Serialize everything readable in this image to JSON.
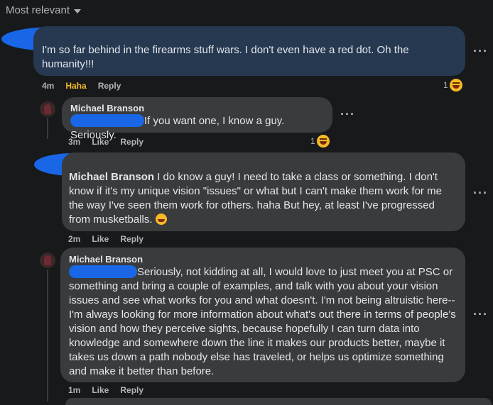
{
  "header": {
    "sort_label": "Most relevant"
  },
  "comments": [
    {
      "author": "",
      "text": "I'm so far behind in the firearms stuff wars. I don't even have a red dot. Oh the humanity!!!",
      "time": "4m",
      "reaction_label": "Haha",
      "reply_label": "Reply",
      "reaction_count": "1",
      "more": "···"
    },
    {
      "author": "Michael Branson",
      "text": "If you want one, I know a guy. Seriously.",
      "time": "3m",
      "like_label": "Like",
      "reply_label": "Reply",
      "reaction_count": "1",
      "more": "···"
    },
    {
      "author": "Michael Branson",
      "text": "I do know a guy! I need to take a class or something. I don't know if it's my unique vision \"issues\" or what but I can't make them work for me the way I've seen them work for others. haha But hey, at least I've progressed from musketballs.",
      "time": "2m",
      "like_label": "Like",
      "reply_label": "Reply",
      "more": "···"
    },
    {
      "author": "Michael Branson",
      "text": "Seriously, not kidding at all, I would love to just meet you at PSC or something and bring a couple of examples, and talk with you about your vision issues and see what works for you and what doesn't. I'm not being altruistic here-- I'm always looking for more information about what's out there in terms of people's vision and how they perceive sights, because hopefully I can turn data into knowledge and somewhere down the line it makes our products better, maybe it takes us down a path nobody else has traveled, or helps us optimize something and make it better than before.",
      "time": "1m",
      "like_label": "Like",
      "reply_label": "Reply",
      "more": "···"
    }
  ],
  "colors": {
    "background": "#18191a",
    "highlight_bubble": "#263951",
    "bubble": "#3a3b3c",
    "redaction": "#1967e6",
    "haha": "#f7b928"
  }
}
